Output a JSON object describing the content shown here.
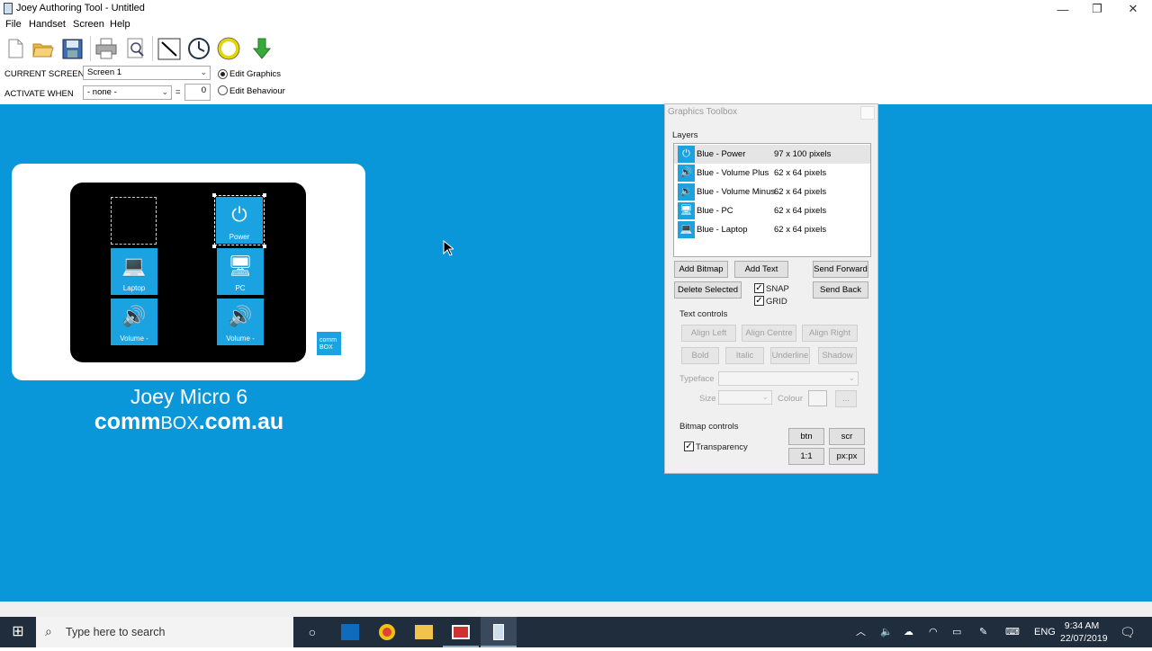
{
  "window": {
    "title": "Joey Authoring Tool - Untitled",
    "minimize": "—",
    "restore": "❐",
    "close": "✕"
  },
  "menu": [
    "File",
    "Handset",
    "Screen",
    "Help"
  ],
  "toolbar": {
    "current_screen_label": "CURRENT SCREEN",
    "current_screen_value": "Screen 1",
    "activate_when_label": "ACTIVATE WHEN",
    "activate_when_value": "- none -",
    "equals": "=",
    "activate_number": "0",
    "edit_graphics": "Edit Graphics",
    "edit_behaviour": "Edit Behaviour"
  },
  "device": {
    "tiles": [
      {
        "label": "Power",
        "glyph": "⏻"
      },
      {
        "label": "Laptop",
        "glyph": "💻"
      },
      {
        "label": "PC",
        "glyph": "🖥"
      },
      {
        "label": "Volume -",
        "glyph": "🔊"
      },
      {
        "label": "Volume -",
        "glyph": "🔊"
      }
    ],
    "logo_line1": "comm",
    "logo_line2": "BOX",
    "brand_line1": "Joey Micro 6",
    "brand_line2_a": "comm",
    "brand_line2_b": "BOX",
    "brand_line2_c": ".com.au"
  },
  "toolbox": {
    "title": "Graphics Toolbox",
    "layers_label": "Layers",
    "layers": [
      {
        "name": "Blue - Power",
        "size": "97 x 100 pixels",
        "glyph": "⏻"
      },
      {
        "name": "Blue - Volume Plus",
        "size": "62 x 64 pixels",
        "glyph": "🔊"
      },
      {
        "name": "Blue - Volume Minus",
        "size": "62 x 64 pixels",
        "glyph": "🔉"
      },
      {
        "name": "Blue - PC",
        "size": "62 x 64 pixels",
        "glyph": "🖥"
      },
      {
        "name": "Blue - Laptop",
        "size": "62 x 64 pixels",
        "glyph": "💻"
      }
    ],
    "add_bitmap": "Add Bitmap",
    "add_text": "Add Text",
    "send_forward": "Send Forward",
    "delete_selected": "Delete Selected",
    "snap": "SNAP",
    "grid": "GRID",
    "send_back": "Send Back",
    "text_controls_label": "Text controls",
    "align_left": "Align Left",
    "align_centre": "Align Centre",
    "align_right": "Align Right",
    "bold": "Bold",
    "italic": "Italic",
    "underline": "Underline",
    "shadow": "Shadow",
    "typeface_label": "Typeface",
    "size_label": "Size",
    "colour_label": "Colour",
    "more": "...",
    "bitmap_controls_label": "Bitmap controls",
    "transparency": "Transparency",
    "btn": "btn",
    "scr": "scr",
    "one_to_one": "1:1",
    "pxpx": "px:px"
  },
  "taskbar": {
    "search_placeholder": "Type here to search",
    "language": "ENG",
    "time": "9:34 AM",
    "date": "22/07/2019"
  }
}
